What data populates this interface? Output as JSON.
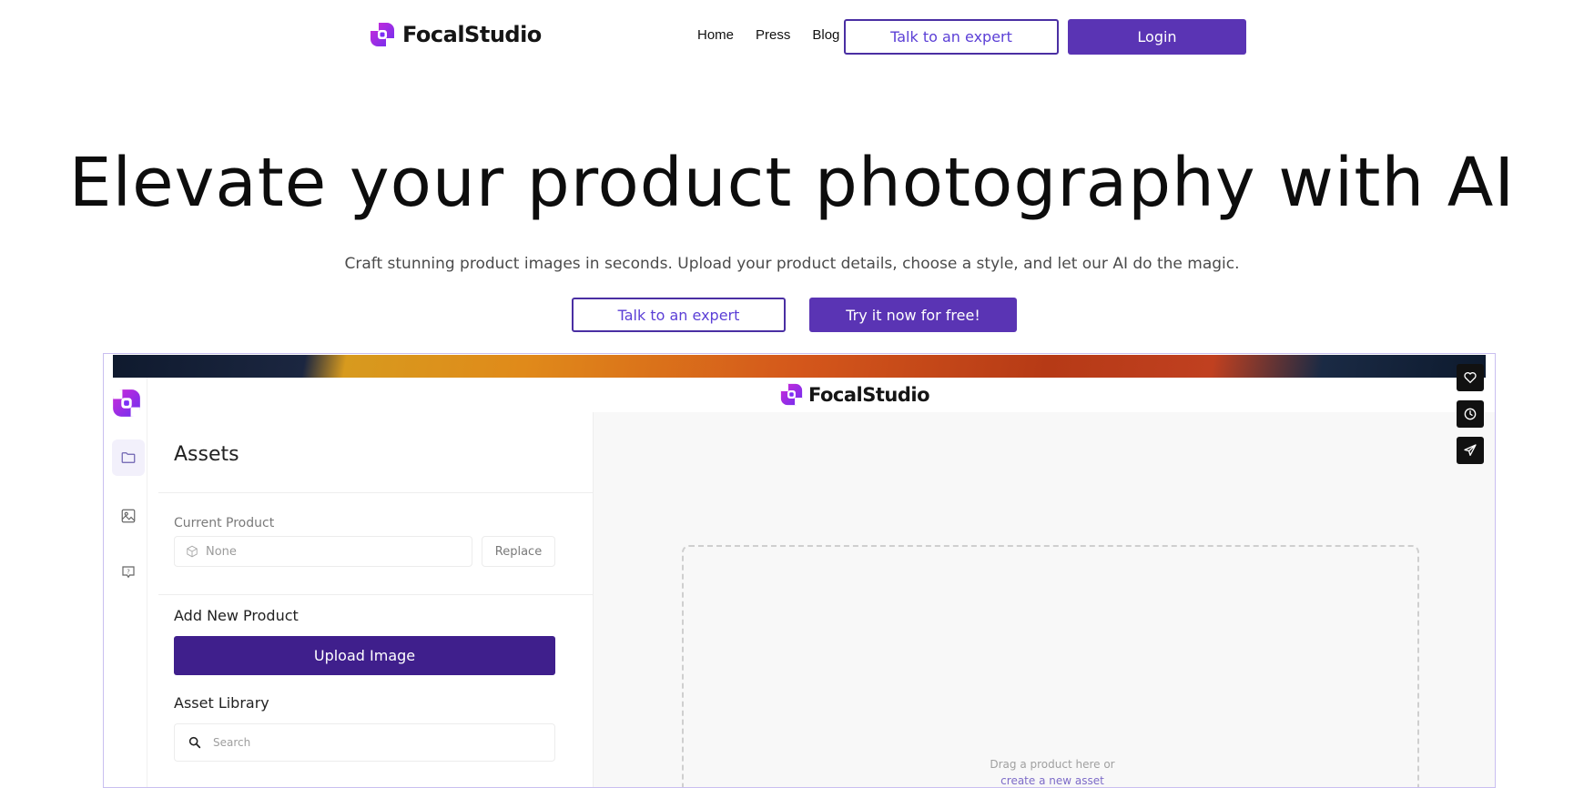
{
  "nav": {
    "brand": "FocalStudio",
    "links": [
      "Home",
      "Press",
      "Blog"
    ],
    "expert_label": "Talk to an expert",
    "login_label": "Login"
  },
  "hero": {
    "title": "Elevate your product photography with AI",
    "subtitle": "Craft stunning product images in seconds. Upload your product details, choose a style, and let our AI do the magic.",
    "expert_label": "Talk to an expert",
    "try_label": "Try it now for free!"
  },
  "app": {
    "brand": "FocalStudio",
    "sidebar_icons": [
      "folder-icon",
      "image-icon",
      "help-icon"
    ],
    "panel": {
      "title": "Assets",
      "current_product_label": "Current Product",
      "current_product_value": "None",
      "replace_label": "Replace",
      "add_new_label": "Add New Product",
      "upload_label": "Upload Image",
      "library_label": "Asset Library",
      "search_placeholder": "Search"
    },
    "canvas": {
      "drop_line1": "Drag a product here or",
      "drop_line2": "create a new asset"
    },
    "actions": [
      "heart-icon",
      "clock-icon",
      "send-icon"
    ]
  },
  "colors": {
    "primary": "#5a34b4",
    "primary_dark": "#3f1f8c",
    "outline": "#4a2fa3",
    "logo_purple": "#7b2ff7",
    "logo_magenta": "#d02bd8"
  }
}
